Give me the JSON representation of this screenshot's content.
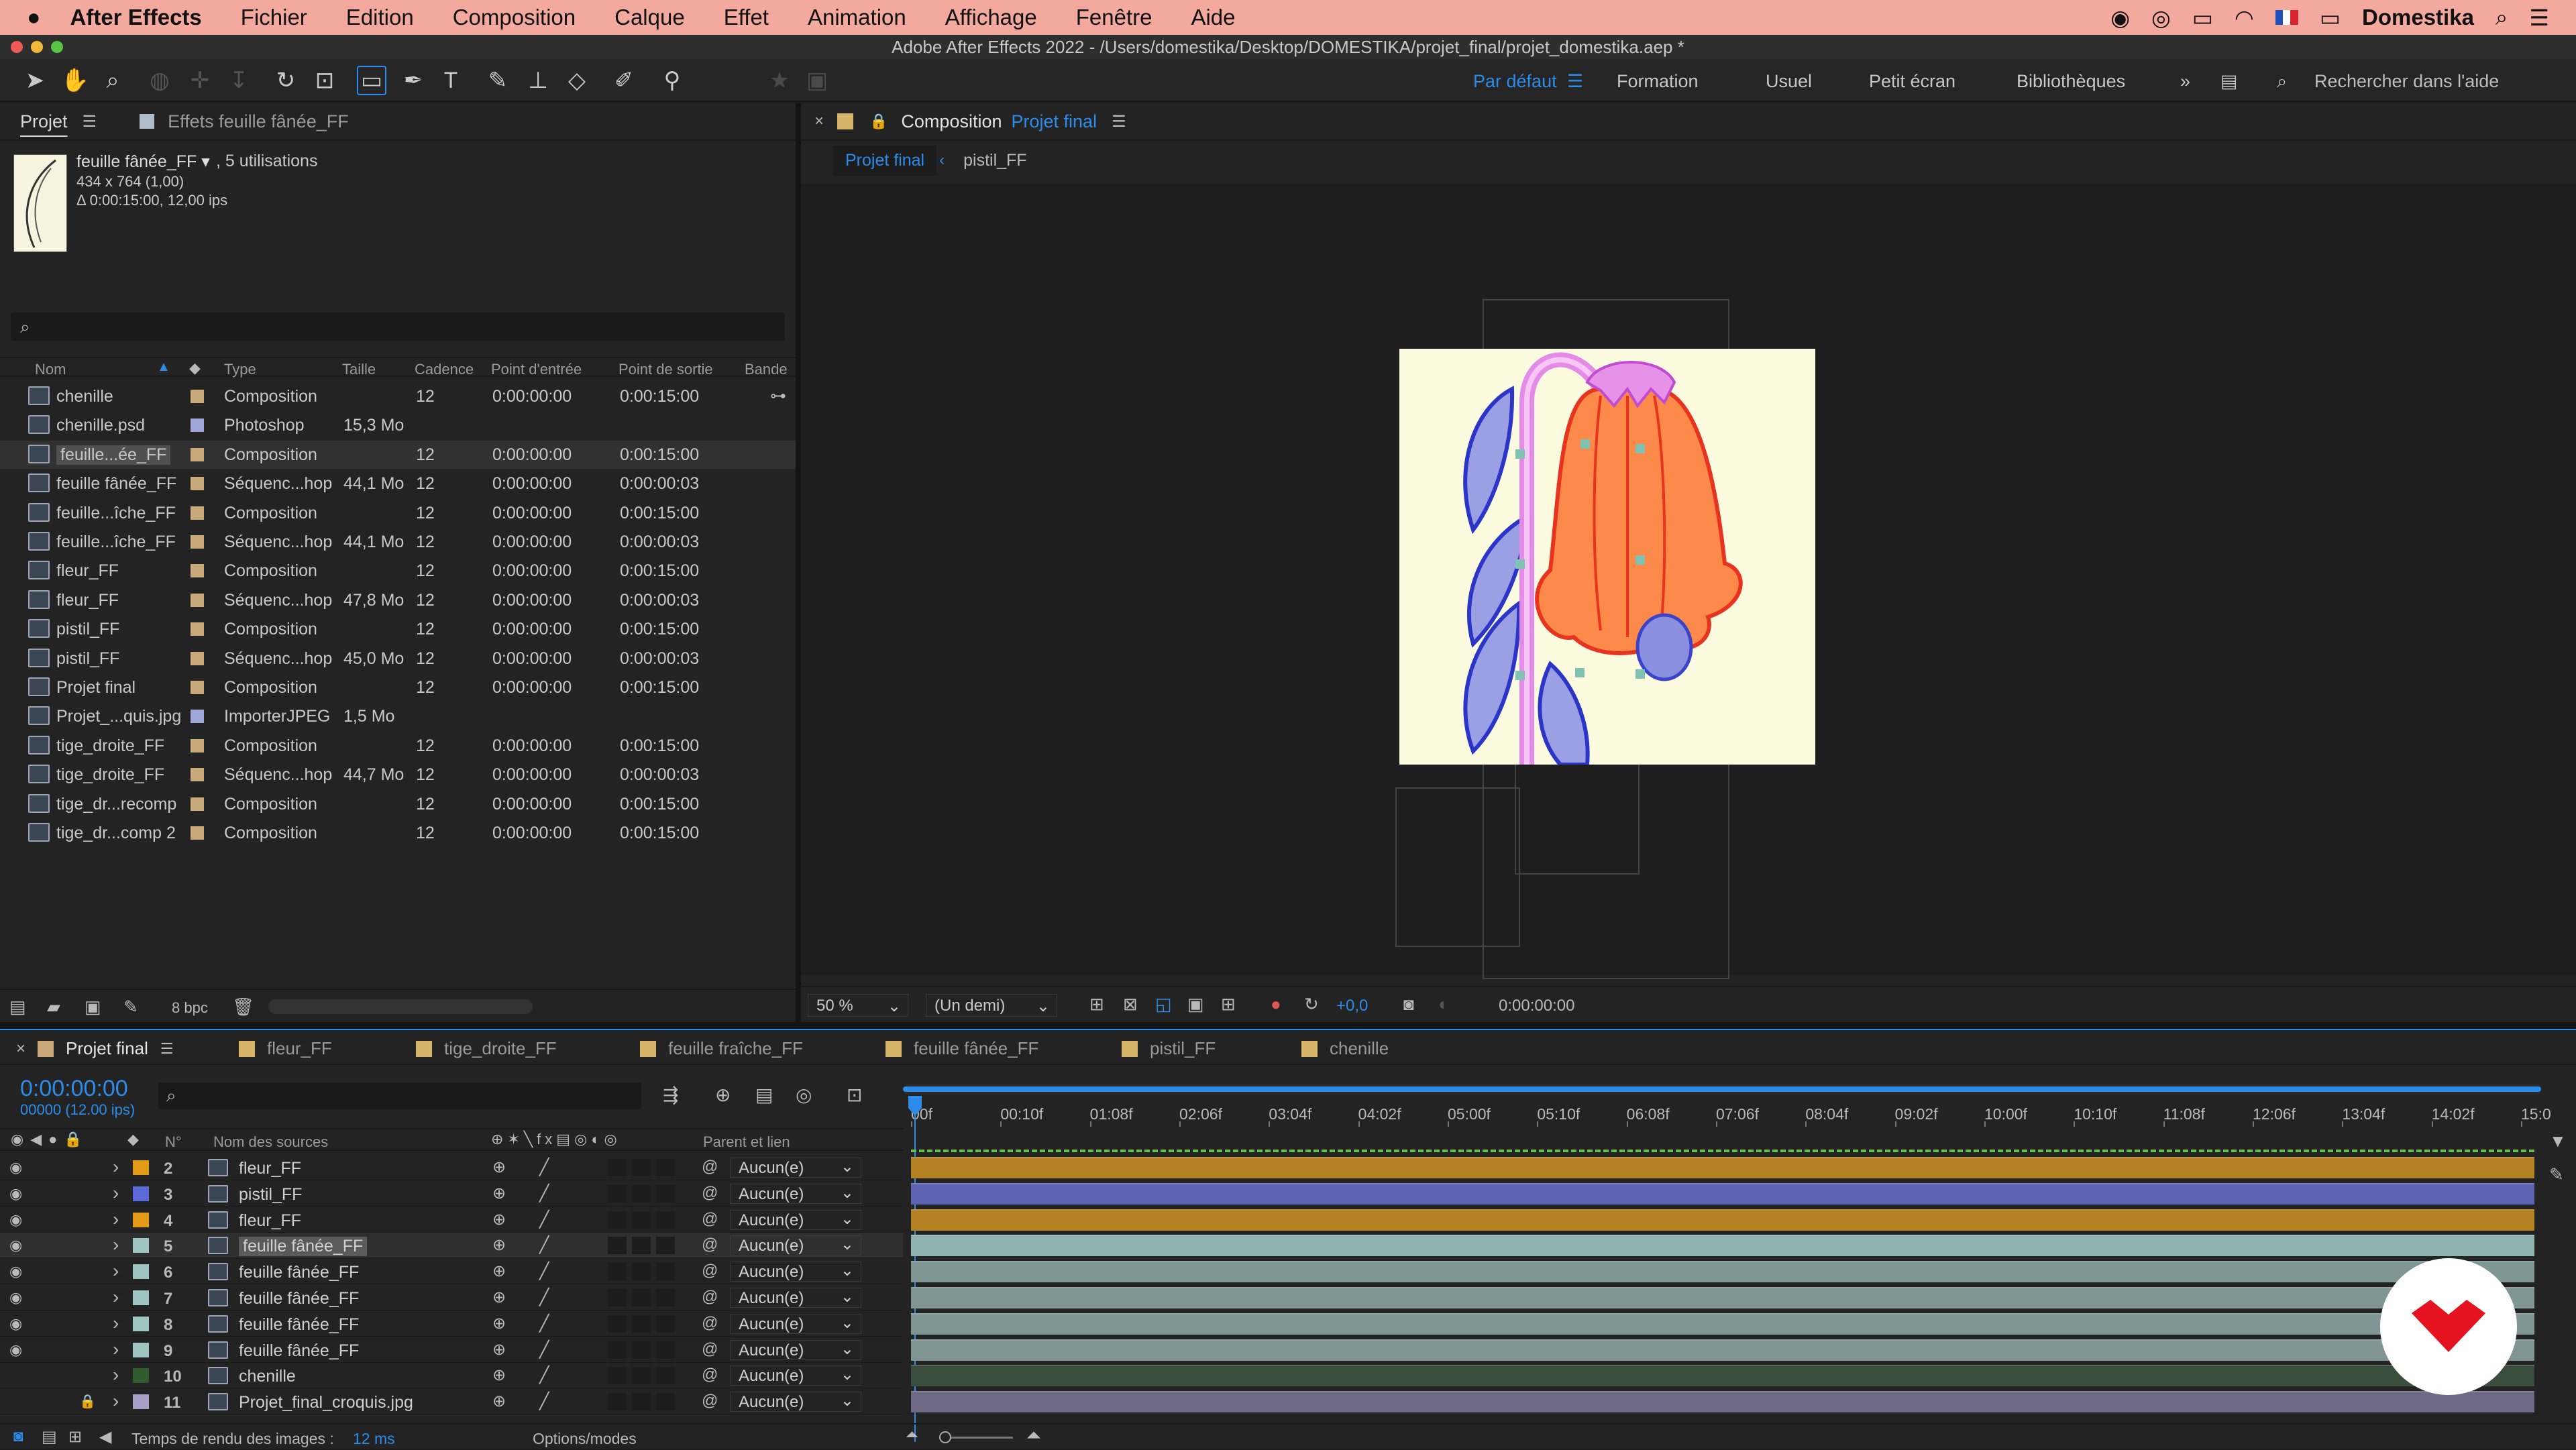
{
  "menubar": {
    "app": "After Effects",
    "items": [
      "Fichier",
      "Edition",
      "Composition",
      "Calque",
      "Effet",
      "Animation",
      "Affichage",
      "Fenêtre",
      "Aide"
    ],
    "user": "Domestika"
  },
  "window_title": "Adobe After Effects 2022 - /Users/domestika/Desktop/DOMESTIKA/projet_final/projet_domestika.aep *",
  "workspaces": [
    "Par défaut",
    "Formation",
    "Usuel",
    "Petit écran",
    "Bibliothèques"
  ],
  "help_search_placeholder": "Rechercher dans l'aide",
  "project_panel": {
    "tab_label": "Projet",
    "effects_tab": "Effets feuille fânée_FF",
    "selected_name": "feuille fânée_FF ▾",
    "selected_usage": ", 5 utilisations",
    "selected_dims": "434 x 764 (1,00)",
    "selected_duration": "Δ 0:00:15:00, 12,00 ips",
    "columns": [
      "Nom",
      "Type",
      "Taille",
      "Cadence",
      "Point d'entrée",
      "Point de sortie",
      "Bande"
    ],
    "items": [
      {
        "name": "chenille",
        "type": "Composition",
        "size": "",
        "rate": "12",
        "in": "0:00:00:00",
        "out": "0:00:15:00",
        "kind": "comp"
      },
      {
        "name": "chenille.psd",
        "type": "Photoshop",
        "size": "15,3 Mo",
        "rate": "",
        "in": "",
        "out": "",
        "kind": "psd"
      },
      {
        "name": "feuille...ée_FF",
        "type": "Composition",
        "size": "",
        "rate": "12",
        "in": "0:00:00:00",
        "out": "0:00:15:00",
        "kind": "comp"
      },
      {
        "name": "feuille fânée_FF",
        "type": "Séquenc...hop",
        "size": "44,1 Mo",
        "rate": "12",
        "in": "0:00:00:00",
        "out": "0:00:00:03",
        "kind": "seq"
      },
      {
        "name": "feuille...îche_FF",
        "type": "Composition",
        "size": "",
        "rate": "12",
        "in": "0:00:00:00",
        "out": "0:00:15:00",
        "kind": "comp"
      },
      {
        "name": "feuille...îche_FF",
        "type": "Séquenc...hop",
        "size": "44,1 Mo",
        "rate": "12",
        "in": "0:00:00:00",
        "out": "0:00:00:03",
        "kind": "seq"
      },
      {
        "name": "fleur_FF",
        "type": "Composition",
        "size": "",
        "rate": "12",
        "in": "0:00:00:00",
        "out": "0:00:15:00",
        "kind": "comp"
      },
      {
        "name": "fleur_FF",
        "type": "Séquenc...hop",
        "size": "47,8 Mo",
        "rate": "12",
        "in": "0:00:00:00",
        "out": "0:00:00:03",
        "kind": "seq"
      },
      {
        "name": "pistil_FF",
        "type": "Composition",
        "size": "",
        "rate": "12",
        "in": "0:00:00:00",
        "out": "0:00:15:00",
        "kind": "comp"
      },
      {
        "name": "pistil_FF",
        "type": "Séquenc...hop",
        "size": "45,0 Mo",
        "rate": "12",
        "in": "0:00:00:00",
        "out": "0:00:00:03",
        "kind": "seq"
      },
      {
        "name": "Projet final",
        "type": "Composition",
        "size": "",
        "rate": "12",
        "in": "0:00:00:00",
        "out": "0:00:15:00",
        "kind": "comp"
      },
      {
        "name": "Projet_...quis.jpg",
        "type": "ImporterJPEG",
        "size": "1,5 Mo",
        "rate": "",
        "in": "",
        "out": "",
        "kind": "jpg"
      },
      {
        "name": "tige_droite_FF",
        "type": "Composition",
        "size": "",
        "rate": "12",
        "in": "0:00:00:00",
        "out": "0:00:15:00",
        "kind": "comp"
      },
      {
        "name": "tige_droite_FF",
        "type": "Séquenc...hop",
        "size": "44,7 Mo",
        "rate": "12",
        "in": "0:00:00:00",
        "out": "0:00:00:03",
        "kind": "seq"
      },
      {
        "name": "tige_dr...recomp",
        "type": "Composition",
        "size": "",
        "rate": "12",
        "in": "0:00:00:00",
        "out": "0:00:15:00",
        "kind": "comp"
      },
      {
        "name": "tige_dr...comp 2",
        "type": "Composition",
        "size": "",
        "rate": "12",
        "in": "0:00:00:00",
        "out": "0:00:15:00",
        "kind": "comp"
      }
    ],
    "bpc": "8 bpc"
  },
  "composition_panel": {
    "label": "Composition",
    "name": "Projet final",
    "breadcrumb": [
      "Projet final",
      "pistil_FF"
    ],
    "zoom": "50 %",
    "resolution": "(Un demi)",
    "exposure": "+0,0",
    "timecode": "0:00:00:00"
  },
  "timeline": {
    "tabs": [
      "Projet final",
      "fleur_FF",
      "tige_droite_FF",
      "feuille fraîche_FF",
      "feuille fânée_FF",
      "pistil_FF",
      "chenille"
    ],
    "timecode": "0:00:00:00",
    "frame_info": "00000 (12.00 ips)",
    "col_num": "N°",
    "col_source": "Nom des sources",
    "col_parent": "Parent et lien",
    "ruler": [
      "00f",
      "00:10f",
      "01:08f",
      "02:06f",
      "03:04f",
      "04:02f",
      "05:00f",
      "05:10f",
      "06:08f",
      "07:06f",
      "08:04f",
      "09:02f",
      "10:00f",
      "10:10f",
      "11:08f",
      "12:06f",
      "13:04f",
      "14:02f",
      "15:0"
    ],
    "layers": [
      {
        "num": "2",
        "name": "fleur_FF",
        "parent": "Aucun(e)",
        "label": "#e39a16",
        "bar": "#b28223",
        "kind": "comp"
      },
      {
        "num": "3",
        "name": "pistil_FF",
        "parent": "Aucun(e)",
        "label": "#5b6ad8",
        "bar": "#5f64b2",
        "kind": "comp"
      },
      {
        "num": "4",
        "name": "fleur_FF",
        "parent": "Aucun(e)",
        "label": "#e39a16",
        "bar": "#b28223",
        "kind": "comp"
      },
      {
        "num": "5",
        "name": "feuille fânée_FF",
        "parent": "Aucun(e)",
        "label": "#9fc5c2",
        "bar": "#8fb3b1",
        "kind": "comp"
      },
      {
        "num": "6",
        "name": "feuille fânée_FF",
        "parent": "Aucun(e)",
        "label": "#9fc5c2",
        "bar": "#7f9694",
        "kind": "comp"
      },
      {
        "num": "7",
        "name": "feuille fânée_FF",
        "parent": "Aucun(e)",
        "label": "#9fc5c2",
        "bar": "#7f9694",
        "kind": "comp"
      },
      {
        "num": "8",
        "name": "feuille fânée_FF",
        "parent": "Aucun(e)",
        "label": "#9fc5c2",
        "bar": "#7f9694",
        "kind": "comp"
      },
      {
        "num": "9",
        "name": "feuille fânée_FF",
        "parent": "Aucun(e)",
        "label": "#9fc5c2",
        "bar": "#7f9694",
        "kind": "comp"
      },
      {
        "num": "10",
        "name": "chenille",
        "parent": "Aucun(e)",
        "label": "#2e5a2e",
        "bar": "#3b4e3d",
        "kind": "comp"
      },
      {
        "num": "11",
        "name": "Projet_final_croquis.jpg",
        "parent": "Aucun(e)",
        "label": "#a8a0c8",
        "bar": "#6e6a86",
        "kind": "jpg"
      }
    ],
    "render_time_label": "Temps de rendu des images :",
    "render_time_value": "12 ms",
    "options_label": "Options/modes"
  },
  "colors": {
    "accent": "#2d8ceb",
    "menubar": "#f3a99d",
    "brand_red": "#e4131f"
  }
}
